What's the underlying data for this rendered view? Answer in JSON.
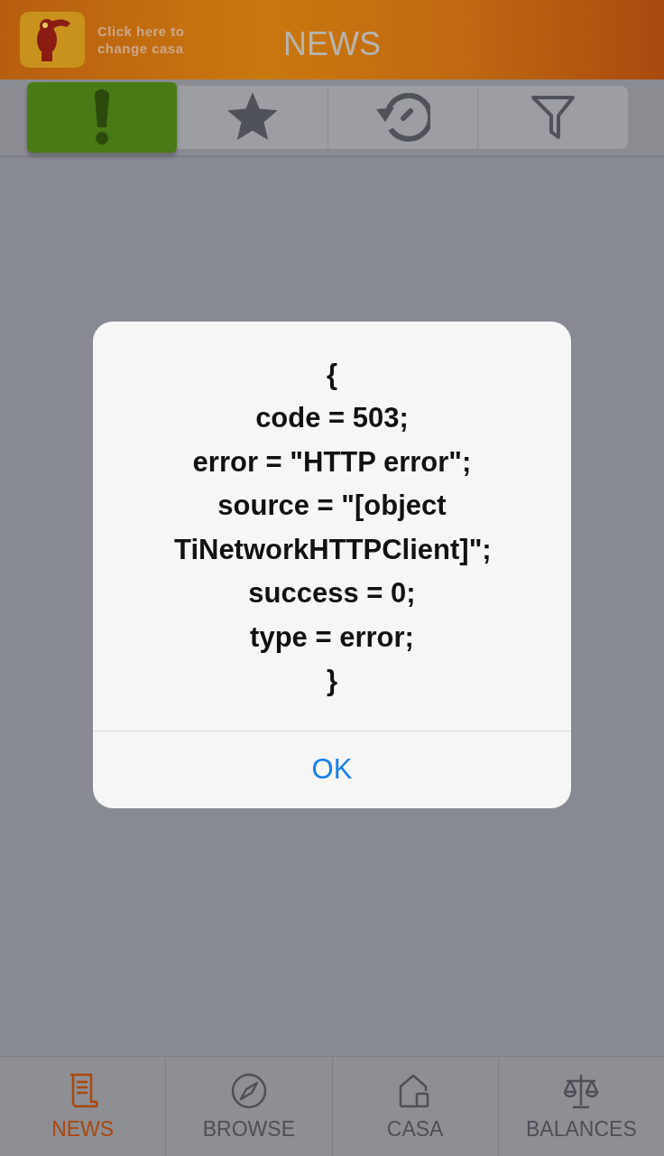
{
  "header": {
    "change_casa": "Click here to change casa",
    "title": "NEWS"
  },
  "segments": [
    {
      "kind": "alert",
      "selected": true
    },
    {
      "kind": "star",
      "selected": false
    },
    {
      "kind": "history",
      "selected": false
    },
    {
      "kind": "filter",
      "selected": false
    }
  ],
  "alert": {
    "message": "{\ncode = 503;\nerror = \"HTTP error\";\nsource = \"[object TiNetworkHTTPClient]\";\nsuccess = 0;\ntype = error;\n}",
    "button": "OK"
  },
  "tab_bar": [
    {
      "kind": "news",
      "label": "NEWS",
      "selected": true
    },
    {
      "kind": "browse",
      "label": "BROWSE",
      "selected": false
    },
    {
      "kind": "casa",
      "label": "CASA",
      "selected": false
    },
    {
      "kind": "balances",
      "label": "BALANCES",
      "selected": false
    }
  ]
}
